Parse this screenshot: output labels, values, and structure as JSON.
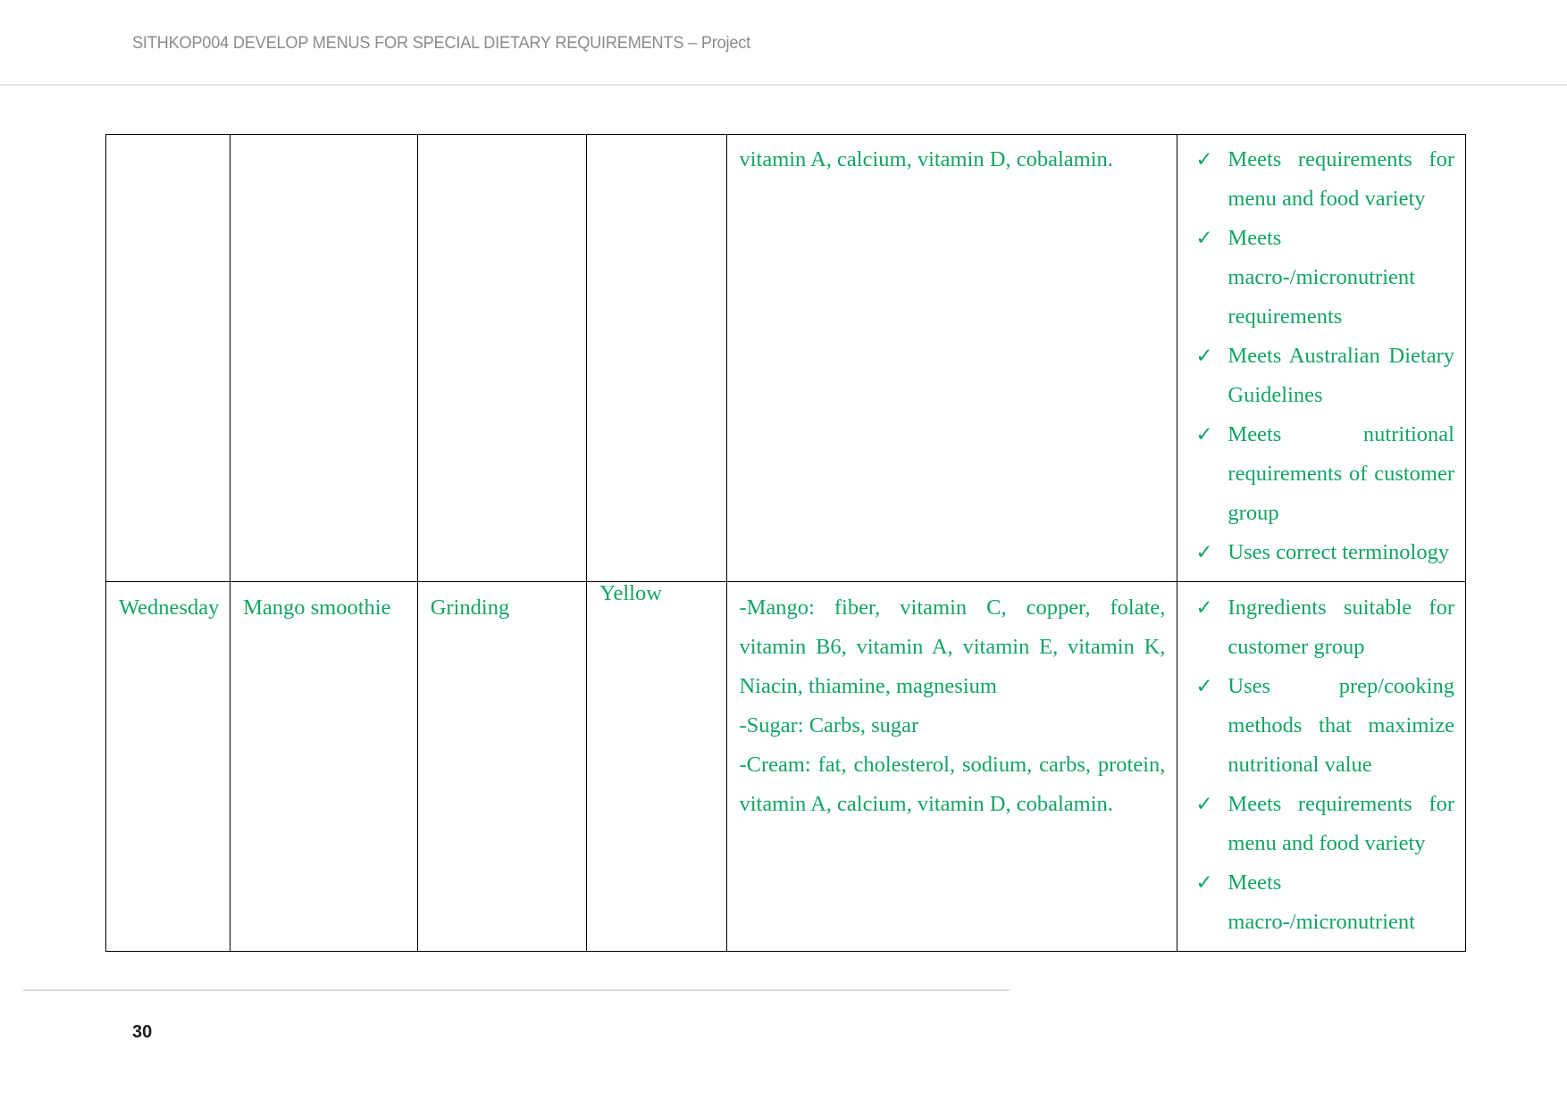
{
  "header": {
    "title": "SITHKOP004 DEVELOP MENUS FOR SPECIAL DIETARY REQUIREMENTS – Project"
  },
  "footer": {
    "page_number": "30"
  },
  "colors": {
    "text_green": "#13a463",
    "header_gray": "#8b8b8b",
    "table_border": "#000000",
    "rule_gray": "#dcdcdc"
  },
  "icons": {
    "tick": "✓"
  },
  "table": {
    "rows": [
      {
        "continued": true,
        "day": "",
        "dish": "",
        "method": "",
        "colour": "",
        "nutrients": [
          "vitamin A, calcium, vitamin D, cobalamin."
        ],
        "checklist": [
          "Meets requirements for menu and food variety",
          "Meets macro-/micronutrient requirements",
          "Meets Australian Dietary Guidelines",
          "Meets nutritional requirements of customer group",
          "Uses correct terminology"
        ]
      },
      {
        "continued": false,
        "day": "Wednesday",
        "dish": "Mango smoothie",
        "method": "Grinding",
        "colour": "Yellow",
        "nutrients": [
          "-Mango: fiber, vitamin C, copper, folate, vitamin B6, vitamin A, vitamin E, vitamin K, Niacin, thiamine, magnesium",
          "-Sugar: Carbs, sugar",
          "-Cream: fat, cholesterol, sodium, carbs, protein, vitamin A, calcium, vitamin D, cobalamin."
        ],
        "checklist": [
          "Ingredients suitable for customer group",
          "Uses prep/cooking methods that maximize nutritional value",
          "Meets requirements for menu and food variety",
          "Meets macro-/micronutrient"
        ]
      }
    ]
  }
}
